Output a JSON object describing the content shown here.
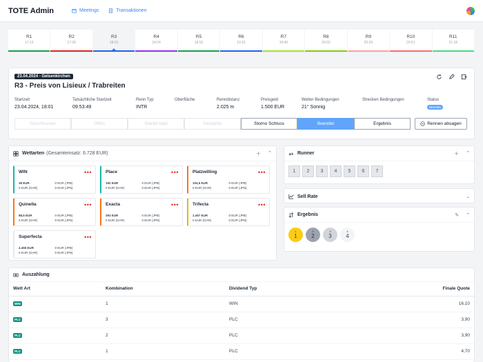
{
  "app": {
    "title": "TOTE Admin"
  },
  "nav": [
    {
      "label": "Meetings",
      "icon": "calendar-icon"
    },
    {
      "label": "Transaktionen",
      "icon": "document-icon"
    }
  ],
  "races": [
    {
      "name": "R1",
      "time": "17:13",
      "color": "#16a34a"
    },
    {
      "name": "R2",
      "time": "17:28",
      "color": "#dc2626"
    },
    {
      "name": "R3",
      "time": "18:01",
      "color": "#2563eb"
    },
    {
      "name": "R4",
      "time": "18:24",
      "color": "#9333ea"
    },
    {
      "name": "R5",
      "time": "18:52",
      "color": "#16a34a"
    },
    {
      "name": "R6",
      "time": "19:15",
      "color": "#2563eb"
    },
    {
      "name": "R7",
      "time": "19:40",
      "color": "#a3e635"
    },
    {
      "name": "R8",
      "time": "20:03",
      "color": "#84cc16"
    },
    {
      "name": "R9",
      "time": "20:29",
      "color": "#fca5a5"
    },
    {
      "name": "R10",
      "time": "20:51",
      "color": "#f87171"
    },
    {
      "name": "R11",
      "time": "21:18",
      "color": "#4ade80"
    }
  ],
  "race": {
    "date_badge": "23.04.2024 - Gelsenkirchen",
    "title": "R3 - Preis von Lisieux / Trabreiten",
    "info": [
      {
        "label": "Startzeit",
        "value": "23.04.2024, 18:01"
      },
      {
        "label": "Tatsächliche Startzeit",
        "value": "09:53:49"
      },
      {
        "label": "Renn Typ",
        "value": "INTR"
      },
      {
        "label": "Oberfläche",
        "value": ""
      },
      {
        "label": "Renndistanz",
        "value": "2.025 m"
      },
      {
        "label": "Preisgeld",
        "value": "1.500 EUR"
      },
      {
        "label": "Wetter Bedingungen",
        "value": "21° Sonnig"
      },
      {
        "label": "Strecken Bedingungen",
        "value": ""
      },
      {
        "label": "Status",
        "value": ""
      }
    ],
    "status_badge": "Beendet",
    "steps": [
      "Geschlossen",
      "Offen",
      "Startet bald",
      "Gestartet",
      "Storno Schluss",
      "Beendet",
      "Ergebnis"
    ],
    "abort_label": "Rennen absagen"
  },
  "wettarten": {
    "title": "Wettarten",
    "subtitle": "(Gesamteinsatz: 6.728 EUR)",
    "items": [
      {
        "name": "WIN",
        "color": "#14b8a6",
        "a": "38 EUR",
        "b": "0 EUR (JPB)",
        "c": "0 EUR (GAR)",
        "d": "0 EUR (JPN)"
      },
      {
        "name": "Place",
        "color": "#14b8a6",
        "a": "192 EUR",
        "b": "0 EUR (JPB)",
        "c": "0 EUR (GAR)",
        "d": "0 EUR (JPN)"
      },
      {
        "name": "Platzwilling",
        "color": "#f97316",
        "a": "104,5 EUR",
        "b": "0 EUR (JPB)",
        "c": "0 EUR (GAR)",
        "d": "0 EUR (JPN)"
      },
      {
        "name": "Quinella",
        "color": "#f97316",
        "a": "88,5 EUR",
        "b": "0 EUR (JPB)",
        "c": "0 EUR (GAR)",
        "d": "0 EUR (JPN)"
      },
      {
        "name": "Exacta",
        "color": "#f97316",
        "a": "393 EUR",
        "b": "0 EUR (JPB)",
        "c": "0 EUR (GAR)",
        "d": "0 EUR (JPN)"
      },
      {
        "name": "Trifecta",
        "color": "#eab308",
        "a": "1.457 EUR",
        "b": "0 EUR (JPB)",
        "c": "0 EUR (GAR)",
        "d": "0 EUR (JPN)"
      },
      {
        "name": "Superfecta",
        "color": "#e5e7eb",
        "a": "4.455 EUR",
        "b": "0 EUR (JPB)",
        "c": "0 EUR (GAR)",
        "d": "0 EUR (JPN)"
      }
    ]
  },
  "runner": {
    "title": "Runner",
    "numbers": [
      "1",
      "2",
      "3",
      "4",
      "5",
      "6",
      "7"
    ]
  },
  "sell_rate": {
    "title": "Sell Rate"
  },
  "ergebnis": {
    "title": "Ergebnis",
    "places": [
      {
        "rank": "1",
        "runner": "1",
        "bg": "#facc15",
        "fg": "#78350f"
      },
      {
        "rank": "2",
        "runner": "2",
        "bg": "#9ca3af",
        "fg": "#1f2937"
      },
      {
        "rank": "3",
        "runner": "3",
        "bg": "#d1d5db",
        "fg": "#374151"
      },
      {
        "rank": "4",
        "runner": "4",
        "bg": "#f3f4f6",
        "fg": "#374151"
      }
    ]
  },
  "auszahlung": {
    "title": "Auszahlung",
    "columns": [
      "Wett Art",
      "Kombination",
      "Dividend Typ",
      "Finale Quote"
    ],
    "rows": [
      {
        "type": "WIN",
        "combo": "1",
        "div": "WIN",
        "quote": "16,10"
      },
      {
        "type": "PLC",
        "combo": "3",
        "div": "PLC",
        "quote": "3,90"
      },
      {
        "type": "PLC",
        "combo": "2",
        "div": "PLC",
        "quote": "3,90"
      },
      {
        "type": "PLC",
        "combo": "1",
        "div": "PLC",
        "quote": "4,70"
      }
    ]
  }
}
